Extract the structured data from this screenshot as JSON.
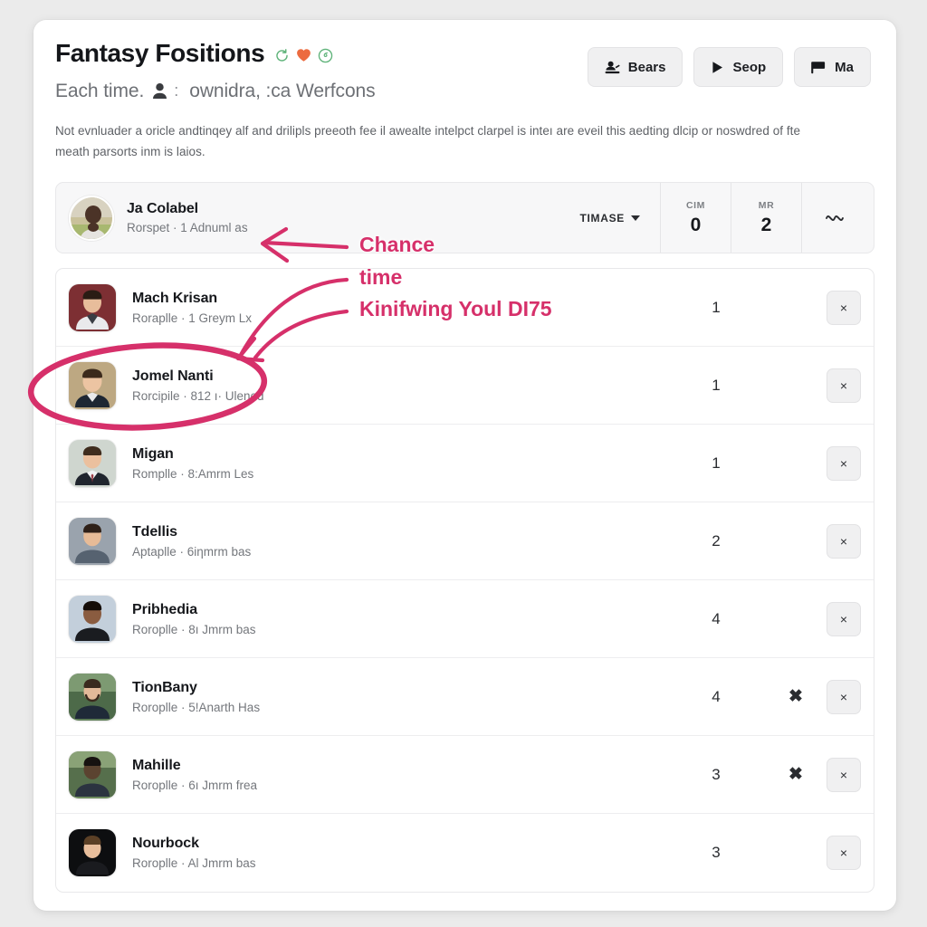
{
  "header": {
    "title": "Fantasy Fositions",
    "title_icons": [
      "refresh-icon",
      "heart-icon",
      "circle-badge-icon"
    ],
    "subtitle_prefix": "Each time.",
    "subtitle_colon": ":",
    "subtitle_rest": "ownidra, :ca Werfcons",
    "description": "Not evnluader a oricle andtinqey alf and drilipls preeoth fee il awealte intelpct clarpel is inteı are eveil this aedting dlcip or noswdred of fte meath parsorts inm is laios.",
    "buttons": [
      {
        "label": "Bears",
        "icon": "stamp-person-icon"
      },
      {
        "label": "Seop",
        "icon": "play-icon"
      },
      {
        "label": "Ma",
        "icon": "flag-icon"
      }
    ]
  },
  "feature_row": {
    "name": "Ja Colabel",
    "sub": "Rorspet · 1 Adnuml as",
    "selector_label": "TIMASE",
    "stats": [
      {
        "key": "CIM",
        "value": "0"
      },
      {
        "key": "MR",
        "value": "2"
      }
    ],
    "wave_glyph": "~"
  },
  "list": {
    "rows": [
      {
        "name": "Mach Krisan",
        "sub": "Roraplle · 1 Greym Lx",
        "count": "1",
        "extra_x": false,
        "close_label": "×",
        "avatar": "avatar-mach-krisan"
      },
      {
        "name": "Jomel Nanti",
        "sub": "Rorcipile · 812 ı· Ulened",
        "count": "1",
        "extra_x": false,
        "close_label": "×",
        "avatar": "avatar-jomel-nanti"
      },
      {
        "name": "Migan",
        "sub": "Romplle · 8:Amrm Les",
        "count": "1",
        "extra_x": false,
        "close_label": "×",
        "avatar": "avatar-migan"
      },
      {
        "name": "Tdellis",
        "sub": "Aptaplle · 6iƞmrm bas",
        "count": "2",
        "extra_x": false,
        "close_label": "×",
        "avatar": "avatar-tdellis"
      },
      {
        "name": "Pribhedia",
        "sub": "Roroplle · 8ı Jmrm bas",
        "count": "4",
        "extra_x": false,
        "close_label": "×",
        "avatar": "avatar-pribhedia"
      },
      {
        "name": "TionBany",
        "sub": "Roroplle · 5!Anarth Has",
        "count": "4",
        "extra_x": true,
        "extra_x_label": "✖",
        "close_label": "×",
        "avatar": "avatar-tionbany"
      },
      {
        "name": "Mahille",
        "sub": "Roroplle · 6ı Jmrm frea",
        "count": "3",
        "extra_x": true,
        "extra_x_label": "✖",
        "close_label": "×",
        "avatar": "avatar-mahille"
      },
      {
        "name": "Nourbock",
        "sub": "Roroplle · Al Jmrm bas",
        "count": "3",
        "extra_x": false,
        "close_label": "×",
        "avatar": "avatar-nourbock"
      }
    ]
  },
  "annotations": {
    "color": "#d6306a",
    "chance": "Chance",
    "time": "time",
    "kinifwing": "Kinifwing Youl DI75",
    "ellipse_target": "Jomel Nanti"
  },
  "colors": {
    "page_background": "#ebebeb",
    "card_background": "#ffffff",
    "feature_row_background": "#f7f7f8",
    "button_background": "#f0f0f1",
    "annotation": "#d6306a",
    "title_text": "#14161a",
    "muted_text": "#74777c"
  }
}
